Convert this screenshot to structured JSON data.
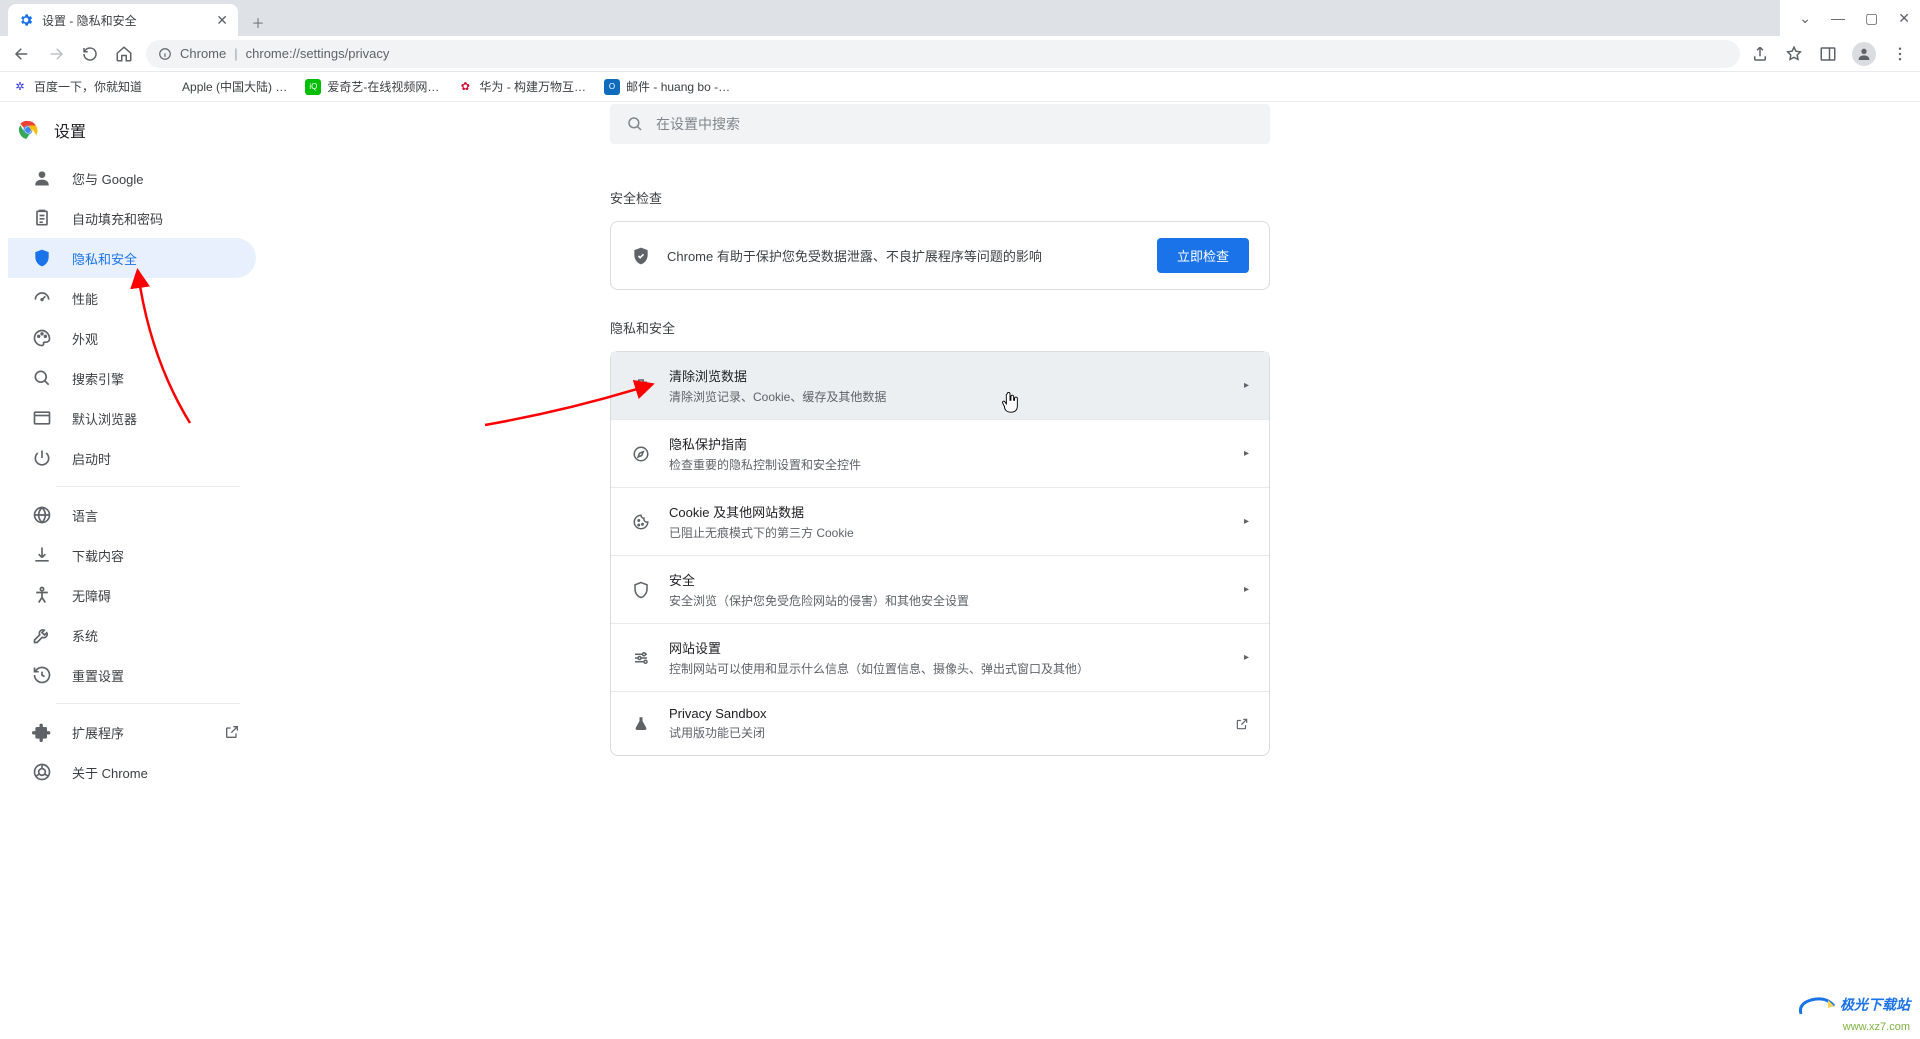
{
  "window": {
    "minimize": "—",
    "maximize": "▢",
    "close": "✕",
    "dropdown": "⌄"
  },
  "tab": {
    "title": "设置 - 隐私和安全"
  },
  "nav": {
    "url_site": "Chrome",
    "url_path": "chrome://settings/privacy"
  },
  "bookmarks": [
    {
      "label": "百度一下，你就知道",
      "color": "#2932e1",
      "glyph": "✿"
    },
    {
      "label": "Apple (中国大陆) …",
      "color": "#a2aaad",
      "glyph": ""
    },
    {
      "label": "爱奇艺-在线视频网…",
      "color": "#00be06",
      "glyph": "iQ"
    },
    {
      "label": "华为 - 构建万物互…",
      "color": "#cf0a2c",
      "glyph": "❀"
    },
    {
      "label": "邮件 - huang bo -…",
      "color": "#0f6cbd",
      "glyph": "O"
    }
  ],
  "header": {
    "title": "设置"
  },
  "search": {
    "placeholder": "在设置中搜索"
  },
  "sidebar": {
    "items": [
      {
        "label": "您与 Google"
      },
      {
        "label": "自动填充和密码"
      },
      {
        "label": "隐私和安全"
      },
      {
        "label": "性能"
      },
      {
        "label": "外观"
      },
      {
        "label": "搜索引擎"
      },
      {
        "label": "默认浏览器"
      },
      {
        "label": "启动时"
      }
    ],
    "items2": [
      {
        "label": "语言"
      },
      {
        "label": "下载内容"
      },
      {
        "label": "无障碍"
      },
      {
        "label": "系统"
      },
      {
        "label": "重置设置"
      }
    ],
    "items3": [
      {
        "label": "扩展程序"
      },
      {
        "label": "关于 Chrome"
      }
    ]
  },
  "safety": {
    "section": "安全检查",
    "msg": "Chrome 有助于保护您免受数据泄露、不良扩展程序等问题的影响",
    "btn": "立即检查"
  },
  "privacy": {
    "section": "隐私和安全",
    "rows": [
      {
        "title": "清除浏览数据",
        "sub": "清除浏览记录、Cookie、缓存及其他数据"
      },
      {
        "title": "隐私保护指南",
        "sub": "检查重要的隐私控制设置和安全控件"
      },
      {
        "title": "Cookie 及其他网站数据",
        "sub": "已阻止无痕模式下的第三方 Cookie"
      },
      {
        "title": "安全",
        "sub": "安全浏览（保护您免受危险网站的侵害）和其他安全设置"
      },
      {
        "title": "网站设置",
        "sub": "控制网站可以使用和显示什么信息（如位置信息、摄像头、弹出式窗口及其他）"
      },
      {
        "title": "Privacy Sandbox",
        "sub": "试用版功能已关闭"
      }
    ]
  },
  "watermark": {
    "l1": "极光下载站",
    "l2": "www.xz7.com"
  }
}
